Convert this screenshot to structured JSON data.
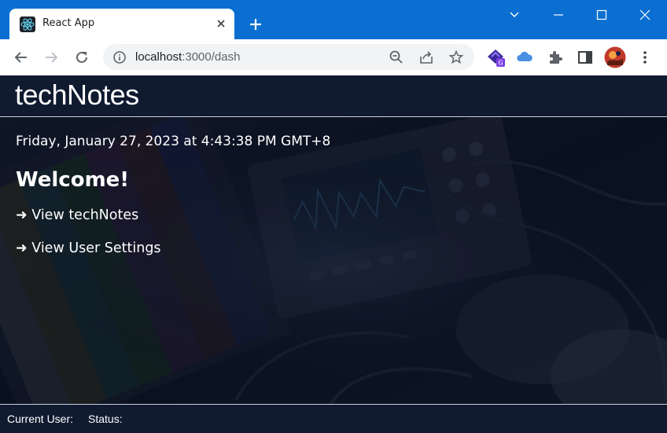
{
  "browser": {
    "tab_title": "React App",
    "url_host": "localhost",
    "url_rest": ":3000/dash"
  },
  "app": {
    "brand": "techNotes",
    "date_line": "Friday, January 27, 2023 at 4:43:38 PM GMT+8",
    "welcome": "Welcome!",
    "links": [
      {
        "label": "➜ View techNotes"
      },
      {
        "label": "➜ View User Settings"
      }
    ],
    "footer": {
      "current_user_label": "Current User:",
      "status_label": "Status:"
    }
  },
  "icons": {
    "favicon": "react-logo-icon",
    "profile": "avatar-icon"
  },
  "colors": {
    "titlebar": "#0b6fd1",
    "page_bg": "#0f1a2e",
    "header_bg": "#101b30",
    "text": "#ffffff"
  }
}
